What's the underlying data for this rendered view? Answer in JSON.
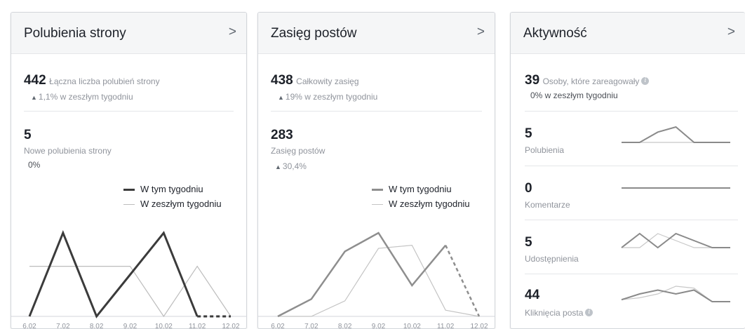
{
  "cards": [
    {
      "title": "Polubienia strony",
      "chevron": ">",
      "total": {
        "value": "442",
        "label": "Łączna liczba polubień strony",
        "change": "1,1% w zeszłym tygodniu"
      },
      "secondary": {
        "value": "5",
        "label": "Nowe polubienia strony",
        "change": "0%"
      },
      "legend": {
        "this_week": "W tym tygodniu",
        "last_week": "W zeszłym tygodniu"
      },
      "colors": {
        "this_week": "#3b3b3b",
        "last_week": "#bdbdbd"
      }
    },
    {
      "title": "Zasięg postów",
      "chevron": ">",
      "total": {
        "value": "438",
        "label": "Całkowity zasięg",
        "change": "19% w zeszłym tygodniu"
      },
      "secondary": {
        "value": "283",
        "label": "Zasięg postów",
        "change": "30,4%"
      },
      "legend": {
        "this_week": "W tym tygodniu",
        "last_week": "W zeszłym tygodniu"
      },
      "colors": {
        "this_week": "#8e8e8e",
        "last_week": "#c4c4c4"
      }
    },
    {
      "title": "Aktywność",
      "chevron": ">",
      "total": {
        "value": "39",
        "label": "Osoby, które zareagowały",
        "change": "0% w zeszłym tygodniu"
      },
      "metrics": [
        {
          "value": "5",
          "label": "Polubienia"
        },
        {
          "value": "0",
          "label": "Komentarze"
        },
        {
          "value": "5",
          "label": "Udostępnienia"
        },
        {
          "value": "44",
          "label": "Kliknięcia posta"
        }
      ]
    }
  ],
  "chart_data": [
    {
      "type": "line",
      "categories": [
        "6.02",
        "7.02",
        "8.02",
        "9.02",
        "10.02",
        "11.02",
        "12.02"
      ],
      "series": [
        {
          "name": "W tym tygodniu",
          "values": [
            0,
            5,
            0,
            2.5,
            5,
            0,
            0
          ],
          "dashed_last": true
        },
        {
          "name": "W zeszłym tygodniu",
          "values": [
            3,
            3,
            3,
            3,
            0,
            3,
            0
          ]
        }
      ],
      "ylim": [
        0,
        5
      ]
    },
    {
      "type": "line",
      "categories": [
        "6.02",
        "7.02",
        "8.02",
        "9.02",
        "10.02",
        "11.02",
        "12.02"
      ],
      "series": [
        {
          "name": "W tym tygodniu",
          "values": [
            0,
            28,
            105,
            135,
            50,
            115,
            0
          ],
          "dashed_last": true
        },
        {
          "name": "W zeszłym tygodniu",
          "values": [
            0,
            0,
            25,
            110,
            115,
            10,
            0
          ]
        }
      ],
      "ylim": [
        0,
        135
      ]
    },
    {
      "type": "line",
      "title": "Polubienia",
      "categories": [
        "6.02",
        "7.02",
        "8.02",
        "9.02",
        "10.02",
        "11.02",
        "12.02"
      ],
      "series": [
        {
          "name": "W tym tygodniu",
          "values": [
            0,
            0,
            2,
            3,
            0,
            0,
            0
          ]
        },
        {
          "name": "W zeszłym tygodniu",
          "values": [
            0,
            0,
            0,
            0,
            0,
            0,
            0
          ]
        }
      ],
      "ylim": [
        0,
        3
      ]
    },
    {
      "type": "line",
      "title": "Komentarze",
      "categories": [
        "6.02",
        "7.02",
        "8.02",
        "9.02",
        "10.02",
        "11.02",
        "12.02"
      ],
      "series": [
        {
          "name": "W tym tygodniu",
          "values": [
            0,
            0,
            0,
            0,
            0,
            0,
            0
          ]
        },
        {
          "name": "W zeszłym tygodniu",
          "values": [
            0,
            0,
            0,
            0,
            0,
            0,
            0
          ]
        }
      ],
      "ylim": [
        0,
        1
      ]
    },
    {
      "type": "line",
      "title": "Udostępnienia",
      "categories": [
        "6.02",
        "7.02",
        "8.02",
        "9.02",
        "10.02",
        "11.02",
        "12.02"
      ],
      "series": [
        {
          "name": "W tym tygodniu",
          "values": [
            0,
            2,
            0,
            2,
            1,
            0,
            0
          ]
        },
        {
          "name": "W zeszłym tygodniu",
          "values": [
            0,
            0,
            2,
            1,
            0,
            0,
            0
          ]
        }
      ],
      "ylim": [
        0,
        2
      ]
    },
    {
      "type": "line",
      "title": "Kliknięcia posta",
      "categories": [
        "6.02",
        "7.02",
        "8.02",
        "9.02",
        "10.02",
        "11.02",
        "12.02"
      ],
      "series": [
        {
          "name": "W tym tygodniu",
          "values": [
            1,
            4,
            6,
            4,
            6,
            0,
            0
          ]
        },
        {
          "name": "W zeszłym tygodniu",
          "values": [
            1,
            2,
            4,
            8,
            7,
            0,
            0
          ]
        }
      ],
      "ylim": [
        0,
        8
      ]
    }
  ]
}
